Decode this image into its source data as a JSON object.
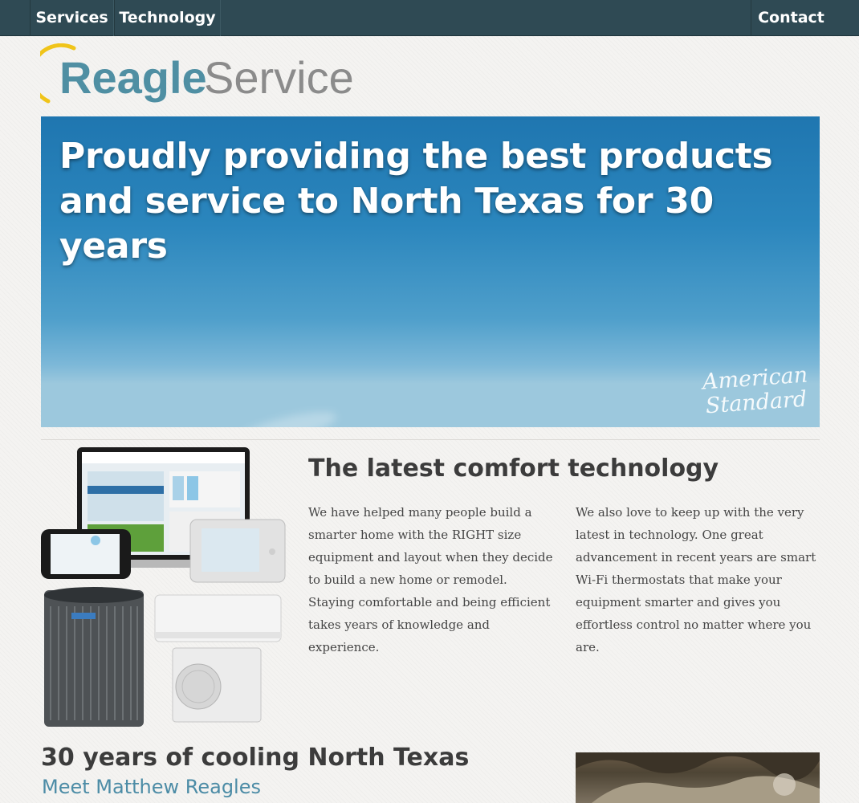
{
  "nav": {
    "services_label": "Services",
    "technology_label": "Technology",
    "contact_label": "Contact"
  },
  "logo": {
    "word_reagle": "Reagle",
    "word_service": "Service"
  },
  "hero": {
    "headline_line1": "Proudly providing the best products",
    "headline_line2": "and service to North Texas for 30 years",
    "brand_line1": "American",
    "brand_line2": "Standard"
  },
  "tech": {
    "title": "The latest comfort technology",
    "paragraph1": "We have helped many people build a smarter home with the RIGHT size equipment and layout when they decide to build a new home or remodel. Staying comfortable and being efficient takes years of knowledge and experience.",
    "paragraph2": "We also love to keep up with the very latest in technology. One great advancement in recent years are smart Wi-Fi thermostats that make your equipment smarter and gives you effortless control no matter where you are."
  },
  "about": {
    "title": "30 years of cooling North Texas",
    "link": "Meet Matthew Reagles"
  },
  "colors": {
    "nav_bg": "#2f4a54",
    "logo_teal": "#4f8fa3",
    "logo_gray": "#8b8b8b",
    "logo_arc": "#f0c419",
    "link": "#4c8ca6"
  }
}
